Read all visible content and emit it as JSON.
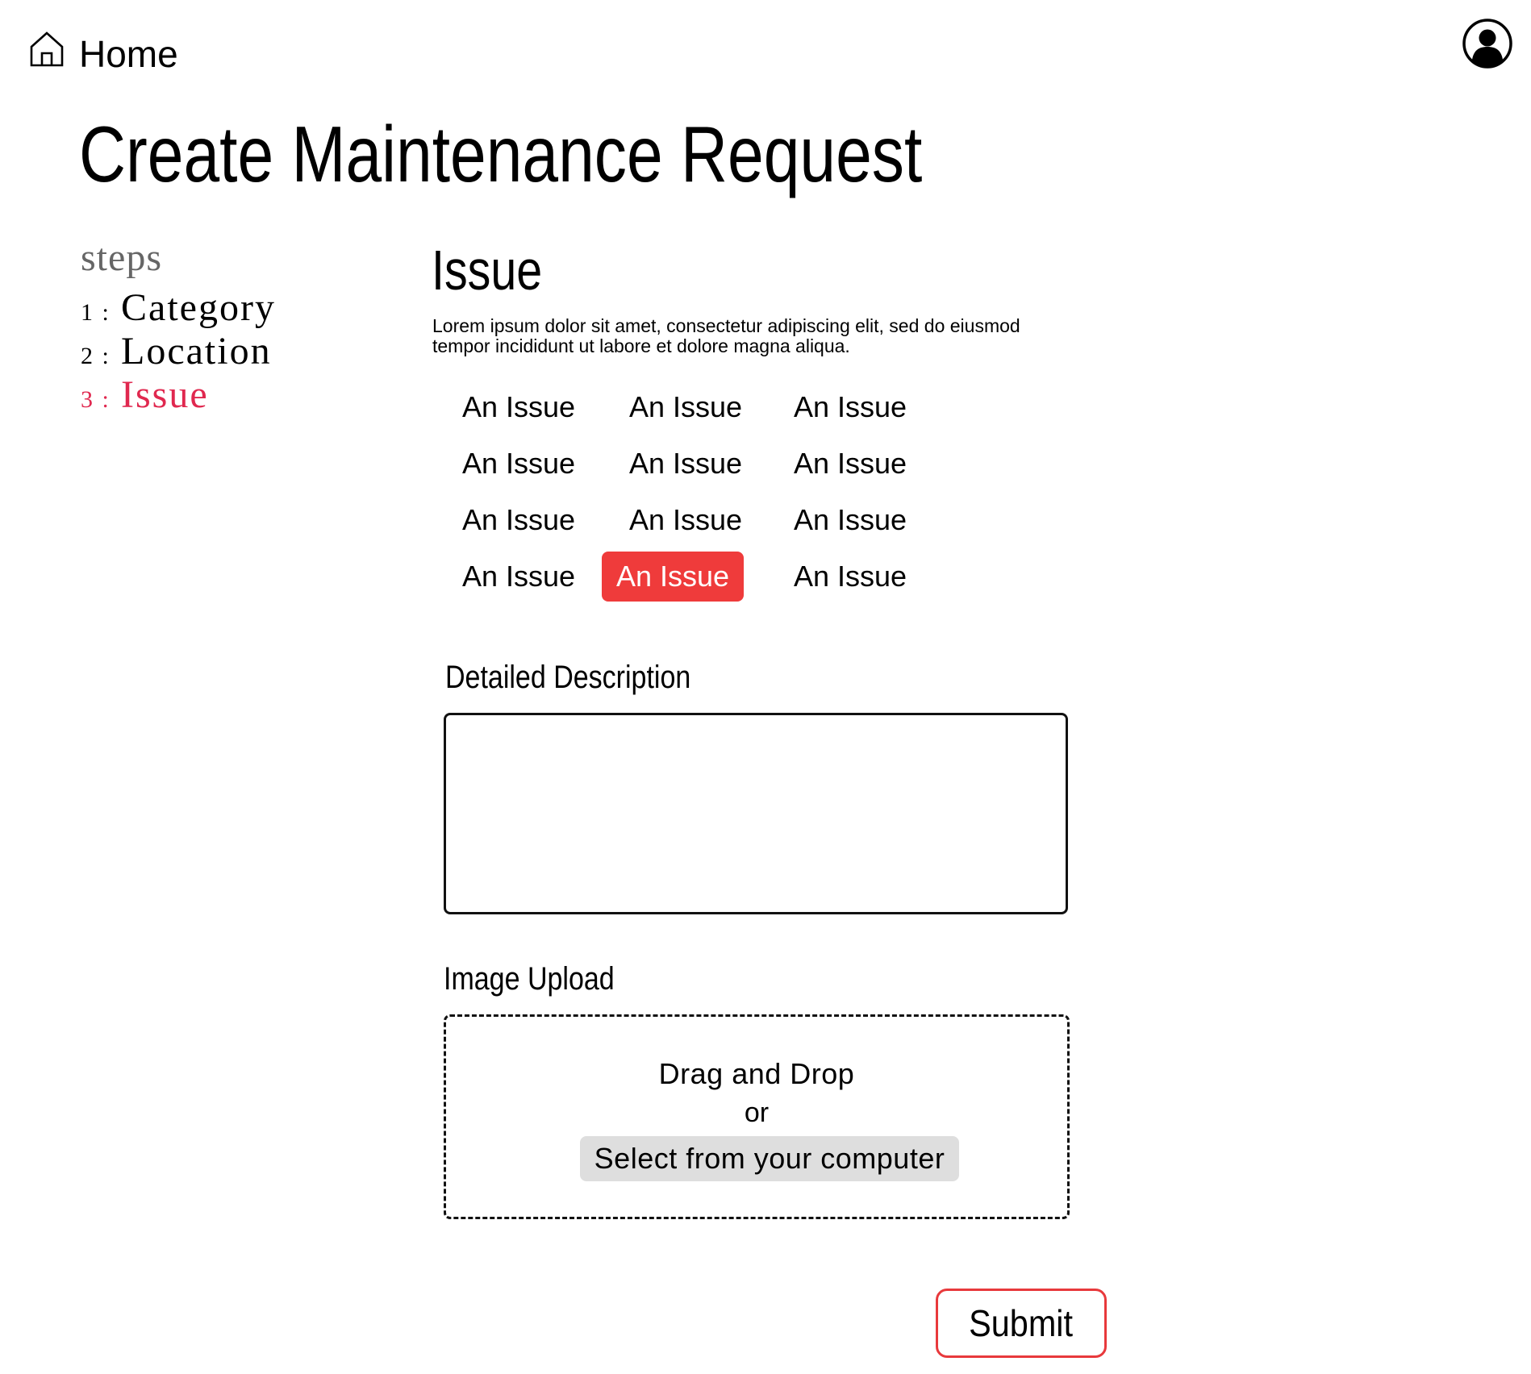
{
  "header": {
    "home_label": "Home"
  },
  "page_title": "Create Maintenance Request",
  "steps": {
    "heading": "steps",
    "items": [
      {
        "number": "1 :",
        "label": "Category",
        "active": false
      },
      {
        "number": "2 :",
        "label": "Location",
        "active": false
      },
      {
        "number": "3 :",
        "label": "Issue",
        "active": true
      }
    ]
  },
  "section": {
    "title": "Issue",
    "description_line1": "Lorem ipsum dolor sit amet, consectetur adipiscing elit, sed do eiusmod",
    "description_line2": "tempor incididunt ut labore et dolore magna aliqua."
  },
  "issues": [
    {
      "label": "An Issue",
      "selected": false
    },
    {
      "label": "An Issue",
      "selected": false
    },
    {
      "label": "An Issue",
      "selected": false
    },
    {
      "label": "An Issue",
      "selected": false
    },
    {
      "label": "An Issue",
      "selected": false
    },
    {
      "label": "An Issue",
      "selected": false
    },
    {
      "label": "An Issue",
      "selected": false
    },
    {
      "label": "An Issue",
      "selected": false
    },
    {
      "label": "An Issue",
      "selected": false
    },
    {
      "label": "An Issue",
      "selected": false
    },
    {
      "label": "An Issue",
      "selected": true
    },
    {
      "label": "An Issue",
      "selected": false
    }
  ],
  "description_field": {
    "label": "Detailed Description",
    "value": "",
    "placeholder": ""
  },
  "upload": {
    "label": "Image Upload",
    "drag_text": "Drag and Drop",
    "or_text": "or",
    "select_label": "Select from your computer"
  },
  "submit_label": "Submit",
  "colors": {
    "accent_step": "#e0284f",
    "selected_issue_bg": "#ef3b3b",
    "submit_border": "#e8393c",
    "select_button_bg": "#dedede"
  },
  "icons": {
    "home": "home-icon",
    "profile": "user-profile-icon"
  }
}
